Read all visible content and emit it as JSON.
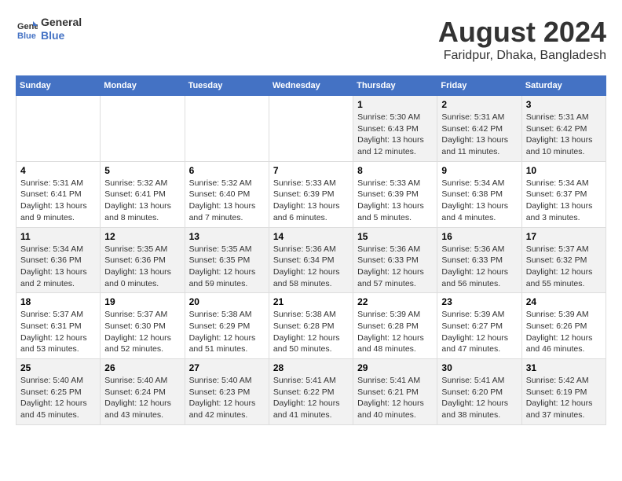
{
  "logo": {
    "line1": "General",
    "line2": "Blue"
  },
  "title": "August 2024",
  "subtitle": "Faridpur, Dhaka, Bangladesh",
  "days_of_week": [
    "Sunday",
    "Monday",
    "Tuesday",
    "Wednesday",
    "Thursday",
    "Friday",
    "Saturday"
  ],
  "weeks": [
    [
      {
        "day": "",
        "info": ""
      },
      {
        "day": "",
        "info": ""
      },
      {
        "day": "",
        "info": ""
      },
      {
        "day": "",
        "info": ""
      },
      {
        "day": "1",
        "info": "Sunrise: 5:30 AM\nSunset: 6:43 PM\nDaylight: 13 hours\nand 12 minutes."
      },
      {
        "day": "2",
        "info": "Sunrise: 5:31 AM\nSunset: 6:42 PM\nDaylight: 13 hours\nand 11 minutes."
      },
      {
        "day": "3",
        "info": "Sunrise: 5:31 AM\nSunset: 6:42 PM\nDaylight: 13 hours\nand 10 minutes."
      }
    ],
    [
      {
        "day": "4",
        "info": "Sunrise: 5:31 AM\nSunset: 6:41 PM\nDaylight: 13 hours\nand 9 minutes."
      },
      {
        "day": "5",
        "info": "Sunrise: 5:32 AM\nSunset: 6:41 PM\nDaylight: 13 hours\nand 8 minutes."
      },
      {
        "day": "6",
        "info": "Sunrise: 5:32 AM\nSunset: 6:40 PM\nDaylight: 13 hours\nand 7 minutes."
      },
      {
        "day": "7",
        "info": "Sunrise: 5:33 AM\nSunset: 6:39 PM\nDaylight: 13 hours\nand 6 minutes."
      },
      {
        "day": "8",
        "info": "Sunrise: 5:33 AM\nSunset: 6:39 PM\nDaylight: 13 hours\nand 5 minutes."
      },
      {
        "day": "9",
        "info": "Sunrise: 5:34 AM\nSunset: 6:38 PM\nDaylight: 13 hours\nand 4 minutes."
      },
      {
        "day": "10",
        "info": "Sunrise: 5:34 AM\nSunset: 6:37 PM\nDaylight: 13 hours\nand 3 minutes."
      }
    ],
    [
      {
        "day": "11",
        "info": "Sunrise: 5:34 AM\nSunset: 6:36 PM\nDaylight: 13 hours\nand 2 minutes."
      },
      {
        "day": "12",
        "info": "Sunrise: 5:35 AM\nSunset: 6:36 PM\nDaylight: 13 hours\nand 0 minutes."
      },
      {
        "day": "13",
        "info": "Sunrise: 5:35 AM\nSunset: 6:35 PM\nDaylight: 12 hours\nand 59 minutes."
      },
      {
        "day": "14",
        "info": "Sunrise: 5:36 AM\nSunset: 6:34 PM\nDaylight: 12 hours\nand 58 minutes."
      },
      {
        "day": "15",
        "info": "Sunrise: 5:36 AM\nSunset: 6:33 PM\nDaylight: 12 hours\nand 57 minutes."
      },
      {
        "day": "16",
        "info": "Sunrise: 5:36 AM\nSunset: 6:33 PM\nDaylight: 12 hours\nand 56 minutes."
      },
      {
        "day": "17",
        "info": "Sunrise: 5:37 AM\nSunset: 6:32 PM\nDaylight: 12 hours\nand 55 minutes."
      }
    ],
    [
      {
        "day": "18",
        "info": "Sunrise: 5:37 AM\nSunset: 6:31 PM\nDaylight: 12 hours\nand 53 minutes."
      },
      {
        "day": "19",
        "info": "Sunrise: 5:37 AM\nSunset: 6:30 PM\nDaylight: 12 hours\nand 52 minutes."
      },
      {
        "day": "20",
        "info": "Sunrise: 5:38 AM\nSunset: 6:29 PM\nDaylight: 12 hours\nand 51 minutes."
      },
      {
        "day": "21",
        "info": "Sunrise: 5:38 AM\nSunset: 6:28 PM\nDaylight: 12 hours\nand 50 minutes."
      },
      {
        "day": "22",
        "info": "Sunrise: 5:39 AM\nSunset: 6:28 PM\nDaylight: 12 hours\nand 48 minutes."
      },
      {
        "day": "23",
        "info": "Sunrise: 5:39 AM\nSunset: 6:27 PM\nDaylight: 12 hours\nand 47 minutes."
      },
      {
        "day": "24",
        "info": "Sunrise: 5:39 AM\nSunset: 6:26 PM\nDaylight: 12 hours\nand 46 minutes."
      }
    ],
    [
      {
        "day": "25",
        "info": "Sunrise: 5:40 AM\nSunset: 6:25 PM\nDaylight: 12 hours\nand 45 minutes."
      },
      {
        "day": "26",
        "info": "Sunrise: 5:40 AM\nSunset: 6:24 PM\nDaylight: 12 hours\nand 43 minutes."
      },
      {
        "day": "27",
        "info": "Sunrise: 5:40 AM\nSunset: 6:23 PM\nDaylight: 12 hours\nand 42 minutes."
      },
      {
        "day": "28",
        "info": "Sunrise: 5:41 AM\nSunset: 6:22 PM\nDaylight: 12 hours\nand 41 minutes."
      },
      {
        "day": "29",
        "info": "Sunrise: 5:41 AM\nSunset: 6:21 PM\nDaylight: 12 hours\nand 40 minutes."
      },
      {
        "day": "30",
        "info": "Sunrise: 5:41 AM\nSunset: 6:20 PM\nDaylight: 12 hours\nand 38 minutes."
      },
      {
        "day": "31",
        "info": "Sunrise: 5:42 AM\nSunset: 6:19 PM\nDaylight: 12 hours\nand 37 minutes."
      }
    ]
  ]
}
